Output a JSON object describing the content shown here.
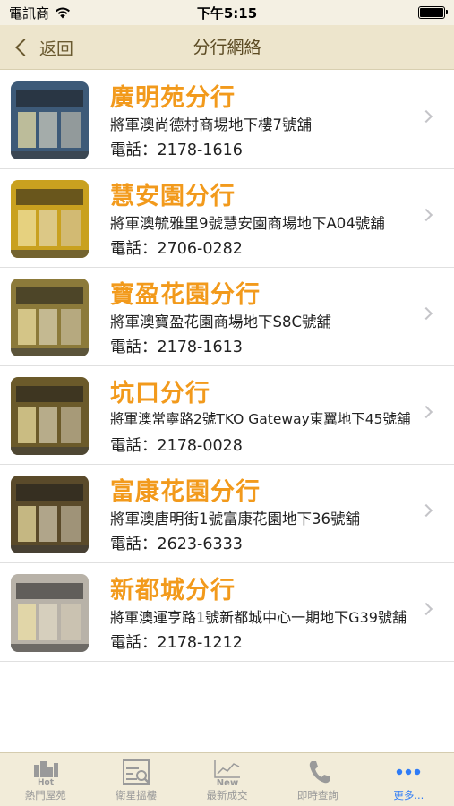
{
  "status": {
    "carrier": "電訊商",
    "time": "下午5:15"
  },
  "nav": {
    "back_label": "返回",
    "title": "分行網絡"
  },
  "branches": [
    {
      "name": "廣明苑分行",
      "address": "將軍澳尚德村商場地下樓7號舖",
      "phone": "電話：2178-1616",
      "thumb_color": "#3d5a78"
    },
    {
      "name": "慧安園分行",
      "address": "將軍澳毓雅里9號慧安園商場地下A04號舖",
      "phone": "電話：2706-0282",
      "thumb_color": "#c9a11f"
    },
    {
      "name": "寶盈花園分行",
      "address": "將軍澳寶盈花園商場地下S8C號舖",
      "phone": "電話：2178-1613",
      "thumb_color": "#8c7a3a"
    },
    {
      "name": "坑口分行",
      "address": "將軍澳常寧路2號TKO Gateway東翼地下45號舖",
      "phone": "電話：2178-0028",
      "thumb_color": "#6b5a2a"
    },
    {
      "name": "富康花園分行",
      "address": "將軍澳唐明街1號富康花園地下36號舖",
      "phone": "電話：2623-6333",
      "thumb_color": "#5a4a2a"
    },
    {
      "name": "新都城分行",
      "address": "將軍澳運亨路1號新都城中心一期地下G39號舖",
      "phone": "電話：2178-1212",
      "thumb_color": "#b8b2a8"
    }
  ],
  "tabs": [
    {
      "label": "熱門屋苑",
      "icon": "hot-buildings-icon"
    },
    {
      "label": "衛星搵樓",
      "icon": "satellite-search-icon"
    },
    {
      "label": "最新成交",
      "icon": "new-transactions-icon"
    },
    {
      "label": "即時查詢",
      "icon": "phone-icon"
    },
    {
      "label": "更多...",
      "icon": "more-dots-icon",
      "active": true
    }
  ],
  "colors": {
    "accent_orange": "#f29a1c",
    "tab_active": "#2f7cf6",
    "navbar_bg": "#ede5cc"
  }
}
